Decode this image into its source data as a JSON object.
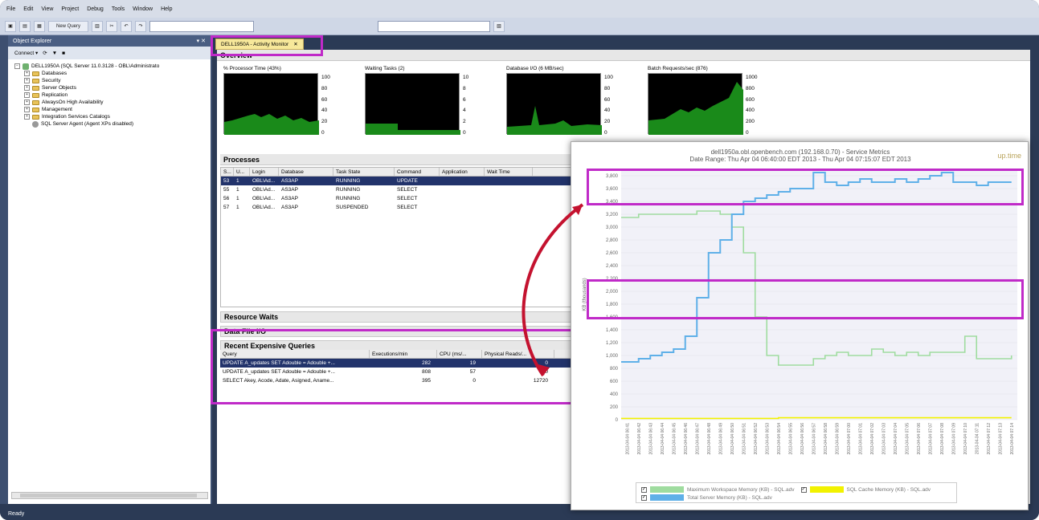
{
  "menu": [
    "File",
    "Edit",
    "View",
    "Project",
    "Debug",
    "Tools",
    "Window",
    "Help"
  ],
  "toolbar": {
    "new_query": "New Query"
  },
  "object_explorer": {
    "title": "Object Explorer",
    "connect": "Connect ▾",
    "server": "DELL1950A (SQL Server 11.0.3128 - OBL\\Administrato",
    "nodes": [
      "Databases",
      "Security",
      "Server Objects",
      "Replication",
      "AlwaysOn High Availability",
      "Management",
      "Integration Services Catalogs"
    ],
    "agent": "SQL Server Agent (Agent XPs disabled)"
  },
  "sidestrip_label": "Toolbox",
  "tab": {
    "label": "DELL1950A - Activity Monitor",
    "close": "✕"
  },
  "overview": {
    "title": "Overview",
    "graphs": [
      {
        "label": "% Processor Time (43%)",
        "axis": [
          "100",
          "80",
          "60",
          "40",
          "20",
          "0"
        ]
      },
      {
        "label": "Waiting Tasks (2)",
        "axis": [
          "10",
          "8",
          "6",
          "4",
          "2",
          "0"
        ]
      },
      {
        "label": "Database I/O (6 MB/sec)",
        "axis": [
          "100",
          "80",
          "60",
          "40",
          "20",
          "0"
        ]
      },
      {
        "label": "Batch Requests/sec (876)",
        "axis": [
          "1000",
          "800",
          "600",
          "400",
          "200",
          "0"
        ]
      }
    ]
  },
  "processes": {
    "title": "Processes",
    "columns": [
      "S...",
      "U...",
      "Login",
      "Database",
      "Task State",
      "Command",
      "Application",
      "Wait Time"
    ],
    "rows": [
      [
        "53",
        "1",
        "OBL\\Ad...",
        "AS3AP",
        "RUNNING",
        "UPDATE",
        "",
        ""
      ],
      [
        "55",
        "1",
        "OBL\\Ad...",
        "AS3AP",
        "RUNNING",
        "SELECT",
        "",
        ""
      ],
      [
        "56",
        "1",
        "OBL\\Ad...",
        "AS3AP",
        "RUNNING",
        "SELECT",
        "",
        ""
      ],
      [
        "57",
        "1",
        "OBL\\Ad...",
        "AS3AP",
        "SUSPENDED",
        "SELECT",
        "",
        ""
      ]
    ]
  },
  "resource_waits": "Resource Waits",
  "data_file_io": "Data File I/O",
  "recent_queries": {
    "title": "Recent Expensive Queries",
    "columns": [
      "Query",
      "Executions/min",
      "CPU (ms/...",
      "Physical Reads/..."
    ],
    "rows": [
      [
        "UPDATE A_updates SET Adouble = Adouble +...",
        "282",
        "19",
        "0"
      ],
      [
        "UPDATE A_updates SET Adouble = Adouble +...",
        "808",
        "57",
        "0"
      ],
      [
        "SELECT Akey, Acode, Adate, Asigned, Aname...",
        "395",
        "0",
        "12720"
      ]
    ]
  },
  "status": "Ready",
  "overlay": {
    "title_line1": "dell1950a.obl.openbench.com (192.168.0.70) - Service Metrics",
    "title_line2": "Date Range: Thu Apr 04 06:40:00 EDT 2013 - Thu Apr 04 07:15:07 EDT 2013",
    "logo": "up.time",
    "ylabel": "KB (thousands)",
    "legend": [
      {
        "label": "Maximum Workspace Memory (KB) - SQL.adv",
        "color": "#9fdc9f"
      },
      {
        "label": "SQL Cache Memory (KB) - SQL.adv",
        "color": "#f2f200"
      },
      {
        "label": "Total Server Memory (KB) - SQL.adv",
        "color": "#5fb0e8"
      }
    ]
  },
  "chart_data": {
    "type": "line",
    "title": "dell1950a.obl.openbench.com (192.168.0.70) - Service Metrics",
    "ylabel": "KB (thousands)",
    "ylim": [
      0,
      3900
    ],
    "yticks": [
      0,
      200,
      400,
      600,
      800,
      1000,
      1200,
      1400,
      1600,
      1800,
      2000,
      2200,
      2400,
      2600,
      2800,
      3000,
      3200,
      3400,
      3600,
      3800
    ],
    "x": [
      "2013-04-04 06:41",
      "2013-04-04 06:42",
      "2013-04-04 06:43",
      "2013-04-04 06:44",
      "2013-04-04 06:45",
      "2013-04-04 06:46",
      "2013-04-04 06:47",
      "2013-04-04 06:48",
      "2013-04-04 06:49",
      "2013-04-04 06:50",
      "2013-04-04 06:51",
      "2013-04-04 06:52",
      "2013-04-04 06:53",
      "2013-04-04 06:54",
      "2013-04-04 06:55",
      "2013-04-04 06:56",
      "2013-04-04 06:57",
      "2013-04-04 06:58",
      "2013-04-04 06:59",
      "2013-04-04 07:00",
      "2013-04-04 07:01",
      "2013-04-04 07:02",
      "2013-04-04 07:03",
      "2013-04-04 07:04",
      "2013-04-04 07:05",
      "2013-04-04 07:06",
      "2013-04-04 07:07",
      "2013-04-04 07:08",
      "2013-04-04 07:09",
      "2013-04-04 07:10",
      "2013-04-04 07:11",
      "2013-04-04 07:12",
      "2013-04-04 07:13",
      "2013-04-04 07:14"
    ],
    "series": [
      {
        "name": "Maximum Workspace Memory (KB) - SQL.adv",
        "values": [
          3150,
          3200,
          3200,
          3200,
          3200,
          3200,
          3250,
          3250,
          3200,
          3000,
          2600,
          1600,
          1000,
          850,
          850,
          850,
          950,
          1000,
          1050,
          1000,
          1000,
          1100,
          1050,
          1000,
          1050,
          1000,
          1050,
          1050,
          1050,
          1300,
          950,
          950,
          950,
          1000
        ]
      },
      {
        "name": "SQL Cache Memory (KB) - SQL.adv",
        "values": [
          20,
          20,
          20,
          20,
          20,
          20,
          20,
          20,
          20,
          20,
          20,
          20,
          20,
          30,
          30,
          30,
          30,
          30,
          30,
          30,
          30,
          30,
          30,
          30,
          30,
          30,
          30,
          30,
          30,
          30,
          30,
          30,
          30,
          30
        ]
      },
      {
        "name": "Total Server Memory (KB) - SQL.adv",
        "values": [
          900,
          950,
          1000,
          1050,
          1100,
          1300,
          1900,
          2600,
          2800,
          3200,
          3400,
          3450,
          3500,
          3550,
          3600,
          3600,
          3850,
          3700,
          3650,
          3700,
          3750,
          3700,
          3700,
          3750,
          3700,
          3750,
          3800,
          3850,
          3700,
          3700,
          3650,
          3700,
          3700,
          3700
        ]
      }
    ]
  }
}
